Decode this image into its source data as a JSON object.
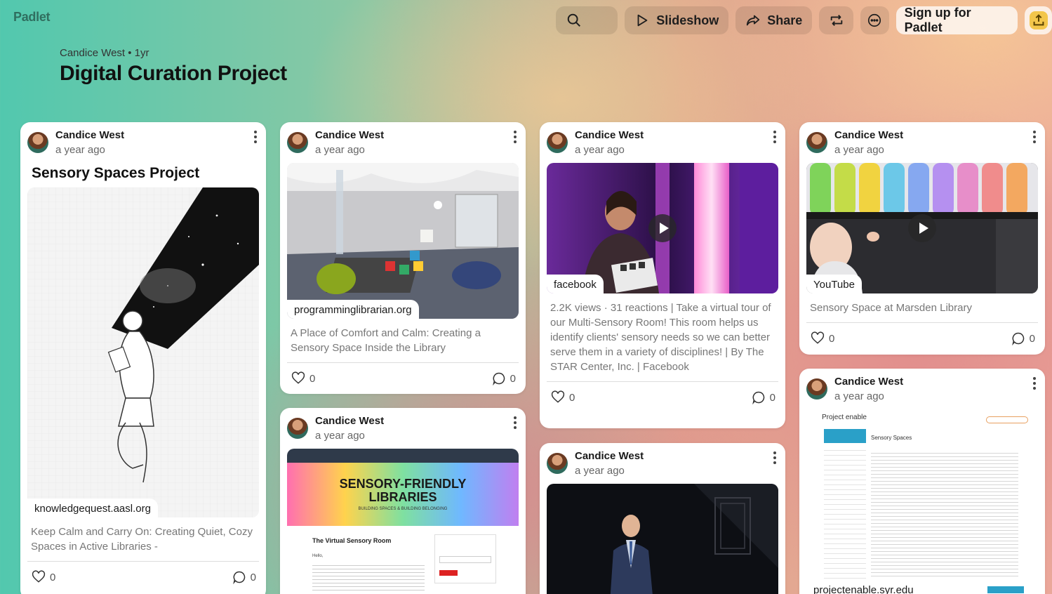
{
  "app": {
    "logo": "Padlet"
  },
  "toolbar": {
    "search_icon": "search-icon",
    "slideshow_label": "Slideshow",
    "share_label": "Share",
    "remake_icon": "remake-icon",
    "more_icon": "more-icon",
    "signup_label": "Sign up for Padlet",
    "accent_color": "#f3c64b"
  },
  "board": {
    "meta": "Candice West • 1yr",
    "title": "Digital Curation Project"
  },
  "posts": [
    {
      "author": "Candice West",
      "ago": "a year ago",
      "title": "Sensory Spaces Project",
      "source": "knowledgequest.aasl.org",
      "description": "Keep Calm and Carry On: Creating Quiet, Cozy Spaces in Active Libraries -",
      "likes": "0",
      "comments": "0"
    },
    {
      "author": "Candice West",
      "ago": "a year ago",
      "source": "programminglibrarian.org",
      "description": "A Place of Comfort and Calm: Creating a Sensory Space Inside the Library",
      "likes": "0",
      "comments": "0"
    },
    {
      "author": "Candice West",
      "ago": "a year ago",
      "source": "facebook",
      "description": "2.2K views · 31 reactions | Take a virtual tour of our Multi-Sensory Room! This room helps us identify clients' sensory needs so we can better serve them in a variety of disciplines! | By The STAR Center, Inc. | Facebook",
      "likes": "0",
      "comments": "0"
    },
    {
      "author": "Candice West",
      "ago": "a year ago",
      "source": "YouTube",
      "description": "Sensory Space at Marsden Library",
      "likes": "0",
      "comments": "0"
    },
    {
      "author": "Candice West",
      "ago": "a year ago",
      "banner_title": "SENSORY-FRIENDLY LIBRARIES",
      "banner_sub": "BUILDING SPACES & BUILDING BELONGING",
      "page_heading": "The Virtual Sensory Room",
      "page_hello": "Hello,"
    },
    {
      "author": "Candice West",
      "ago": "a year ago"
    },
    {
      "author": "Candice West",
      "ago": "a year ago",
      "source": "projectenable.syr.edu",
      "page_logo": "Project enable",
      "page_heading": "Sensory Spaces"
    }
  ]
}
